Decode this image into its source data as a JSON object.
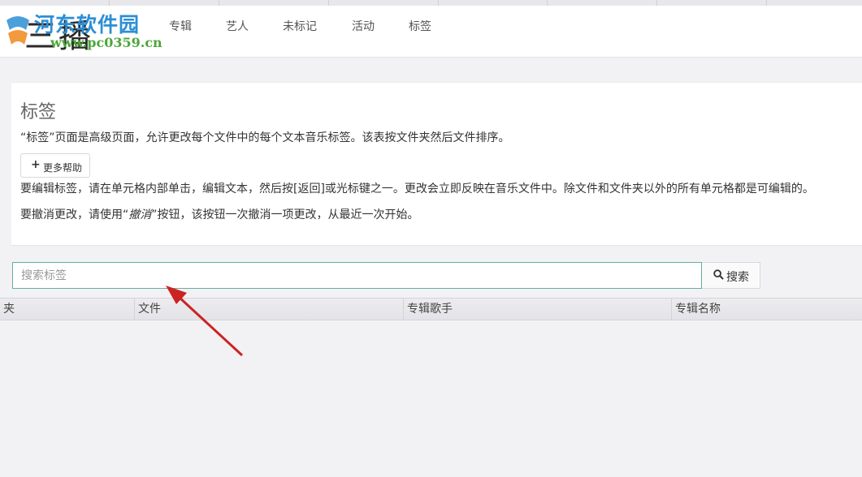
{
  "watermark": {
    "title": "河东软件园",
    "url": "www.pc0359.cn"
  },
  "brand": {
    "text": "三播"
  },
  "nav": {
    "items": [
      "专辑",
      "艺人",
      "未标记",
      "活动",
      "标签"
    ]
  },
  "panel": {
    "title": "标签",
    "description": "“标签”页面是高级页面，允许更改每个文件中的每个文本音乐标签。该表按文件夹然后文件排序。",
    "help_button": "更多帮助",
    "edit_instructions": "要编辑标签，请在单元格内部单击，编辑文本，然后按[返回]或光标键之一。更改会立即反映在音乐文件中。除文件和文件夹以外的所有单元格都是可编辑的。",
    "undo_prefix": "要撤消更改，请使用“",
    "undo_button_name": "撤消",
    "undo_suffix": "”按钮，该按钮一次撤消一项更改，从最近一次开始。"
  },
  "search": {
    "placeholder": "搜索标签",
    "button_label": "搜索"
  },
  "table": {
    "columns": [
      "夹",
      "文件",
      "专辑歌手",
      "专辑名称"
    ]
  },
  "colors": {
    "accent_border": "#66afa0",
    "annotation_arrow": "#cc2222",
    "watermark_blue": "#2c8fd6",
    "watermark_green": "#4ca63a"
  }
}
